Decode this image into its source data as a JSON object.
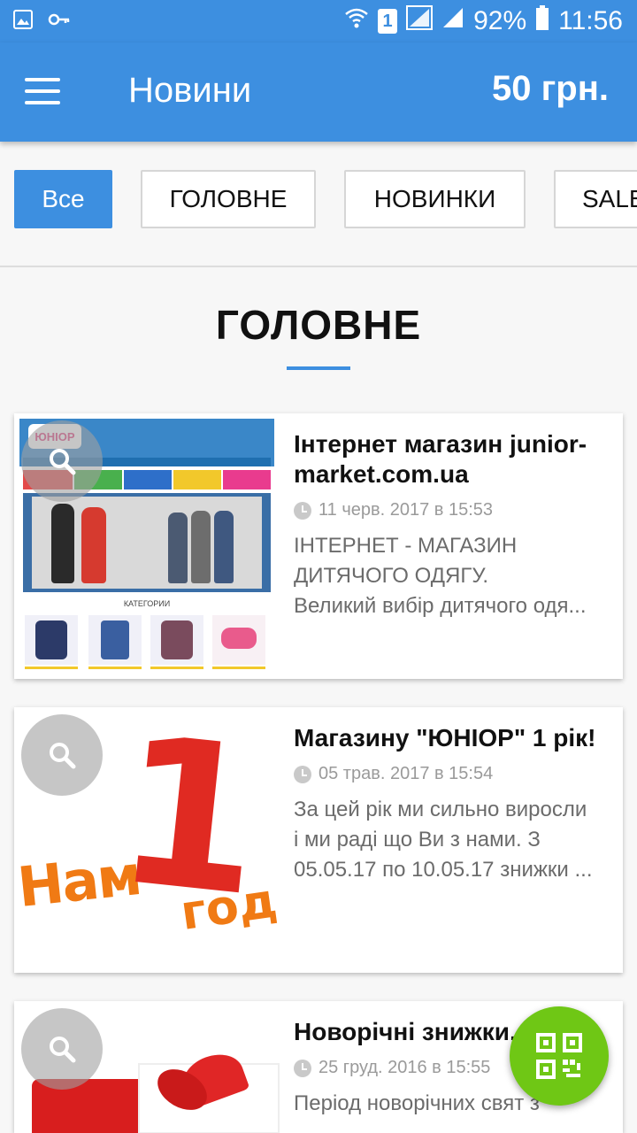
{
  "status_bar": {
    "battery": "92%",
    "time": "11:56",
    "sim_slot": "1",
    "icons": [
      "gallery-icon",
      "key-icon",
      "wifi-icon",
      "sim-icon",
      "signal-icon",
      "battery-icon"
    ]
  },
  "app_bar": {
    "title": "Новини",
    "balance": "50 грн."
  },
  "filters": [
    {
      "label": "Все",
      "active": true
    },
    {
      "label": "ГОЛОВНЕ",
      "active": false
    },
    {
      "label": "НОВИНКИ",
      "active": false
    },
    {
      "label": "SALE",
      "active": false
    }
  ],
  "section": {
    "title": "ГОЛОВНЕ"
  },
  "news": [
    {
      "title": "Інтернет магазин junior-market.com.ua",
      "date": "11 черв. 2017 в 15:53",
      "desc_line1": "ІНТЕРНЕТ - МАГАЗИН",
      "desc_line2": "ДИТЯЧОГО ОДЯГУ.",
      "desc_line3": "Великий вибір дитячого одя...",
      "thumb_logo": "ЮНІОР",
      "thumb_caption": "КАТЕГОРИИ"
    },
    {
      "title": "Магазину \"ЮНІОР\" 1 рік!",
      "date": "05 трав. 2017 в 15:54",
      "desc_line1": "За цей рік ми сильно виросли",
      "desc_line2": "і ми раді що Ви з нами. З",
      "desc_line3": "05.05.17 по 10.05.17 знижки ...",
      "thumb_text_left": "Нам",
      "thumb_text_big": "1",
      "thumb_text_right": "год!"
    },
    {
      "title": "Новорічні знижки, -20%",
      "date": "25 груд. 2016 в 15:55",
      "desc_line1": "Період новорічних свят з"
    }
  ],
  "colors": {
    "primary": "#3d8fe0",
    "fab": "#6fc715",
    "muted_text": "#6b6b6b",
    "date_text": "#9a9a9a"
  }
}
